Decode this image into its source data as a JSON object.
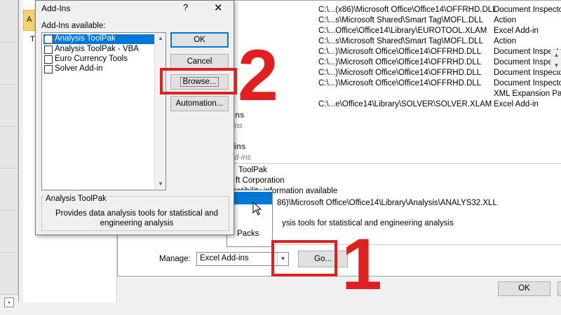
{
  "options_dialog": {
    "addin_rows": [
      {
        "location": "C:\\...(x86)\\Microsoft Office\\Office14\\OFFRHD.DLL",
        "type": "Document Inspecto"
      },
      {
        "location": "C:\\...s\\Microsoft Shared\\Smart Tag\\MOFL.DLL",
        "type": "Action"
      },
      {
        "location": "C:\\...Office\\Office14\\Library\\EUROTOOL.XLAM",
        "type": "Excel Add-in"
      },
      {
        "location": "C:\\...s\\Microsoft Shared\\Smart Tag\\MOFL.DLL",
        "type": "Action"
      },
      {
        "location": "C:\\...)\\Microsoft Office\\Office14\\OFFRHD.DLL",
        "type": "Document Inspecto"
      },
      {
        "location": "C:\\...)\\Microsoft Office\\Office14\\OFFRHD.DLL",
        "type": "Document Inspecto"
      },
      {
        "location": "C:\\...)\\Microsoft Office\\Office14\\OFFRHD.DLL",
        "type": "Document Inspecto"
      },
      {
        "location": "C:\\...)\\Microsoft Office\\Office14\\OFFRHD.DLL",
        "type": "Document Inspecto"
      },
      {
        "location": "",
        "type": "XML Expansion Pac"
      },
      {
        "location": "C:\\...e\\Office14\\Library\\SOLVER\\SOLVER.XLAM",
        "type": "Excel Add-in"
      }
    ],
    "section_fragments": {
      "ns": "ns",
      "ins_italic": "ins",
      "ins_bold": "-ins",
      "add_ins_italic": "dd-ins"
    },
    "details": {
      "addin_name": "ToolPak",
      "publisher": "ft Corporation",
      "compatibility": "patibility information available",
      "location": "86)\\Microsoft Office\\Office14\\Library\\Analysis\\ANALYS32.XLL",
      "description": "ysis tools for statistical and engineering analysis"
    },
    "manage_list_item": "Packs",
    "manage_label": "Manage:",
    "manage_value": "Excel Add-ins",
    "go_label": "Go...",
    "ok_label": "OK"
  },
  "addins_dialog": {
    "title": "Add-Ins",
    "help": "?",
    "close": "✕",
    "available_label": "Add-Ins available:",
    "items": [
      {
        "label": "Analysis ToolPak",
        "checked": false,
        "selected": true
      },
      {
        "label": "Analysis ToolPak - VBA",
        "checked": false,
        "selected": false
      },
      {
        "label": "Euro Currency Tools",
        "checked": false,
        "selected": false
      },
      {
        "label": "Solver Add-in",
        "checked": false,
        "selected": false
      }
    ],
    "buttons": {
      "ok": "OK",
      "cancel": "Cancel",
      "browse": "Browse...",
      "automation": "Automation..."
    },
    "description_title": "Analysis ToolPak",
    "description_text": "Provides data analysis tools for statistical and engineering analysis"
  },
  "annotations": {
    "step1": "1",
    "step2": "2",
    "color": "#e02020"
  },
  "sidebar_letter": "T",
  "sidebar_sel_letter": "A"
}
